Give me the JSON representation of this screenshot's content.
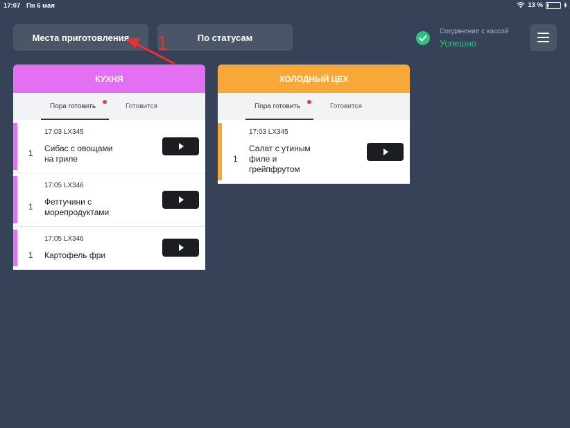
{
  "status_bar": {
    "time": "17:07",
    "date": "Пн 6 мая",
    "battery": "13 %",
    "battery_level": 0.13
  },
  "toolbar": {
    "places_label": "Места приготовления",
    "status_label": "По статусам"
  },
  "connection": {
    "label": "Соединение с кассой",
    "value": "Успешно",
    "color": "#2ec27e"
  },
  "annotation": {
    "number": "1",
    "color": "#e8302f"
  },
  "panels": [
    {
      "title": "КУХНЯ",
      "color": "#e36ff2",
      "tabs": [
        "Пора готовить",
        "Готовится"
      ],
      "orders": [
        {
          "meta": "17:03 LX345",
          "qty": "1",
          "name_lines": [
            "Сибас с овощами",
            "на гриле"
          ]
        },
        {
          "meta": "17:05 LX346",
          "qty": "1",
          "name_lines": [
            "Феттучини с",
            "морепродуктами"
          ]
        },
        {
          "meta": "17:05 LX346",
          "qty": "1",
          "name_lines": [
            "Картофель фри"
          ]
        }
      ]
    },
    {
      "title": "ХОЛОДНЫЙ ЦЕХ",
      "color": "#f7a838",
      "tabs": [
        "Пора готовить",
        "Готовится"
      ],
      "orders": [
        {
          "meta": "17:03 LX345",
          "qty": "1",
          "name_lines": [
            "Салат с утиным",
            "филе и",
            "грейпфрутом"
          ]
        }
      ]
    }
  ]
}
